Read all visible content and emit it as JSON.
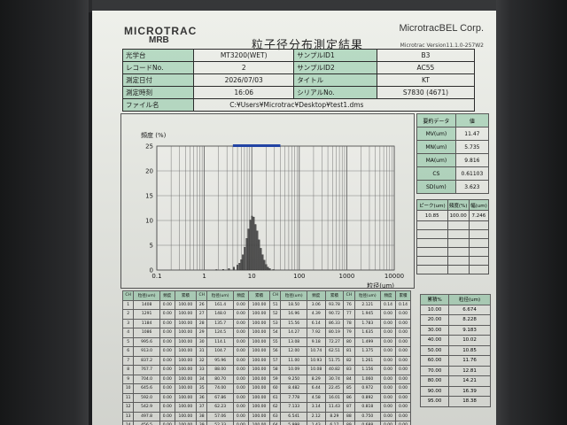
{
  "header": {
    "logo": "MICROTRAC",
    "logo_sub": "MRB",
    "corp": "MicrotracBEL Corp.",
    "title": "粒子径分布測定結果",
    "version": "Microtrac Version11.1.0-257W2"
  },
  "info_rows": [
    [
      "光学台",
      "MT3200(WET)",
      "サンプルID1",
      "B3"
    ],
    [
      "レコードNo.",
      "2",
      "サンプルID2",
      "AC55"
    ],
    [
      "測定日付",
      "2026/07/03",
      "タイトル",
      "KT"
    ],
    [
      "測定時刻",
      "16:06",
      "シリアルNo.",
      "S7830 (4671)"
    ]
  ],
  "file": {
    "label": "ファイル名",
    "value": "C:¥Users¥Microtrac¥Desktop¥test1.dms"
  },
  "stats": {
    "header": [
      "要約データ",
      "値"
    ],
    "rows": [
      [
        "MV(um)",
        "11.47"
      ],
      [
        "MN(um)",
        "5.735"
      ],
      [
        "MA(um)",
        "9.816"
      ],
      [
        "CS",
        "0.61103"
      ],
      [
        "SD(um)",
        "3.623"
      ]
    ]
  },
  "peaks": {
    "header": [
      "ピーク(um)",
      "頻度(%)",
      "幅(um)"
    ],
    "row": [
      "10.85",
      "100.00",
      "7.246"
    ]
  },
  "pct_table": {
    "header": [
      "累積%",
      "粒径(um)"
    ],
    "rows": [
      [
        "10.00",
        "6.674"
      ],
      [
        "20.00",
        "8.228"
      ],
      [
        "30.00",
        "9.183"
      ],
      [
        "40.00",
        "10.02"
      ],
      [
        "50.00",
        "10.85"
      ],
      [
        "60.00",
        "11.76"
      ],
      [
        "70.00",
        "12.81"
      ],
      [
        "80.00",
        "14.21"
      ],
      [
        "90.00",
        "16.39"
      ],
      [
        "95.00",
        "18.38"
      ]
    ]
  },
  "big_table": {
    "header": [
      "CH",
      "粒径(um)",
      "頻度",
      "累積"
    ],
    "rows": [
      [
        "1",
        "1408",
        "0.00",
        "100.00",
        "26",
        "161.4",
        "0.00",
        "100.00",
        "51",
        "18.50",
        "3.06",
        "93.78",
        "76",
        "2.121",
        "0.14",
        "0.14"
      ],
      [
        "2",
        "1291",
        "0.00",
        "100.00",
        "27",
        "148.0",
        "0.00",
        "100.00",
        "52",
        "16.96",
        "4.39",
        "90.72",
        "77",
        "1.945",
        "0.00",
        "0.00"
      ],
      [
        "3",
        "1184",
        "0.00",
        "100.00",
        "28",
        "135.7",
        "0.00",
        "100.00",
        "53",
        "15.56",
        "6.14",
        "86.33",
        "78",
        "1.783",
        "0.00",
        "0.00"
      ],
      [
        "4",
        "1086",
        "0.00",
        "100.00",
        "29",
        "124.5",
        "0.00",
        "100.00",
        "54",
        "14.27",
        "7.92",
        "80.19",
        "79",
        "1.635",
        "0.00",
        "0.00"
      ],
      [
        "5",
        "995.6",
        "0.00",
        "100.00",
        "30",
        "114.1",
        "0.00",
        "100.00",
        "55",
        "13.08",
        "9.18",
        "72.27",
        "80",
        "1.499",
        "0.00",
        "0.00"
      ],
      [
        "6",
        "913.0",
        "0.00",
        "100.00",
        "31",
        "104.7",
        "0.00",
        "100.00",
        "56",
        "12.00",
        "10.74",
        "62.51",
        "81",
        "1.375",
        "0.00",
        "0.00"
      ],
      [
        "7",
        "837.2",
        "0.00",
        "100.00",
        "32",
        "95.96",
        "0.00",
        "100.00",
        "57",
        "11.00",
        "10.93",
        "51.75",
        "82",
        "1.261",
        "0.00",
        "0.00"
      ],
      [
        "8",
        "767.7",
        "0.00",
        "100.00",
        "33",
        "88.00",
        "0.00",
        "100.00",
        "58",
        "10.09",
        "10.08",
        "40.82",
        "83",
        "1.156",
        "0.00",
        "0.00"
      ],
      [
        "9",
        "704.0",
        "0.00",
        "100.00",
        "34",
        "80.70",
        "0.00",
        "100.00",
        "59",
        "9.250",
        "8.29",
        "30.74",
        "84",
        "1.060",
        "0.00",
        "0.00"
      ],
      [
        "10",
        "645.6",
        "0.00",
        "100.00",
        "35",
        "74.00",
        "0.00",
        "100.00",
        "60",
        "8.482",
        "6.44",
        "22.45",
        "85",
        "0.972",
        "0.00",
        "0.00"
      ],
      [
        "11",
        "592.0",
        "0.00",
        "100.00",
        "36",
        "67.86",
        "0.00",
        "100.00",
        "61",
        "7.778",
        "4.58",
        "16.01",
        "86",
        "0.892",
        "0.00",
        "0.00"
      ],
      [
        "12",
        "542.9",
        "0.00",
        "100.00",
        "37",
        "62.23",
        "0.00",
        "100.00",
        "62",
        "7.133",
        "3.14",
        "11.43",
        "87",
        "0.818",
        "0.00",
        "0.00"
      ],
      [
        "13",
        "497.8",
        "0.00",
        "100.00",
        "38",
        "57.06",
        "0.00",
        "100.00",
        "63",
        "6.541",
        "2.12",
        "8.29",
        "88",
        "0.750",
        "0.00",
        "0.00"
      ],
      [
        "14",
        "456.5",
        "0.00",
        "100.00",
        "39",
        "52.33",
        "0.00",
        "100.00",
        "64",
        "5.998",
        "1.43",
        "6.17",
        "89",
        "0.688",
        "0.00",
        "0.00"
      ]
    ]
  },
  "chart_data": {
    "type": "bar",
    "ylabel": "頻度 (%)",
    "xlabel": "粒径(um)",
    "x_scale": "log",
    "xlim": [
      0.1,
      10000
    ],
    "ylim": [
      0,
      25
    ],
    "x_ticks": [
      "0.1",
      "1",
      "10",
      "100",
      "1000",
      "10000"
    ],
    "y_ticks": [
      "0",
      "5",
      "10",
      "15",
      "20",
      "25"
    ],
    "grid": true,
    "range_bar": [
      4,
      40
    ],
    "x": [
      1.8,
      2.5,
      3.3,
      4.2,
      5.0,
      5.5,
      6.0,
      6.5,
      7.1,
      7.8,
      8.5,
      9.25,
      10.1,
      11.0,
      12.0,
      13.1,
      14.3,
      15.6,
      17.0,
      18.5,
      20.2,
      22.0,
      24.0,
      28.5
    ],
    "values": [
      0.1,
      0.15,
      0.3,
      0.6,
      1.0,
      1.4,
      2.1,
      3.1,
      4.6,
      6.4,
      8.3,
      10.1,
      10.9,
      10.7,
      9.2,
      7.9,
      6.1,
      4.4,
      3.1,
      2.0,
      1.1,
      0.6,
      0.3,
      0.1
    ]
  }
}
